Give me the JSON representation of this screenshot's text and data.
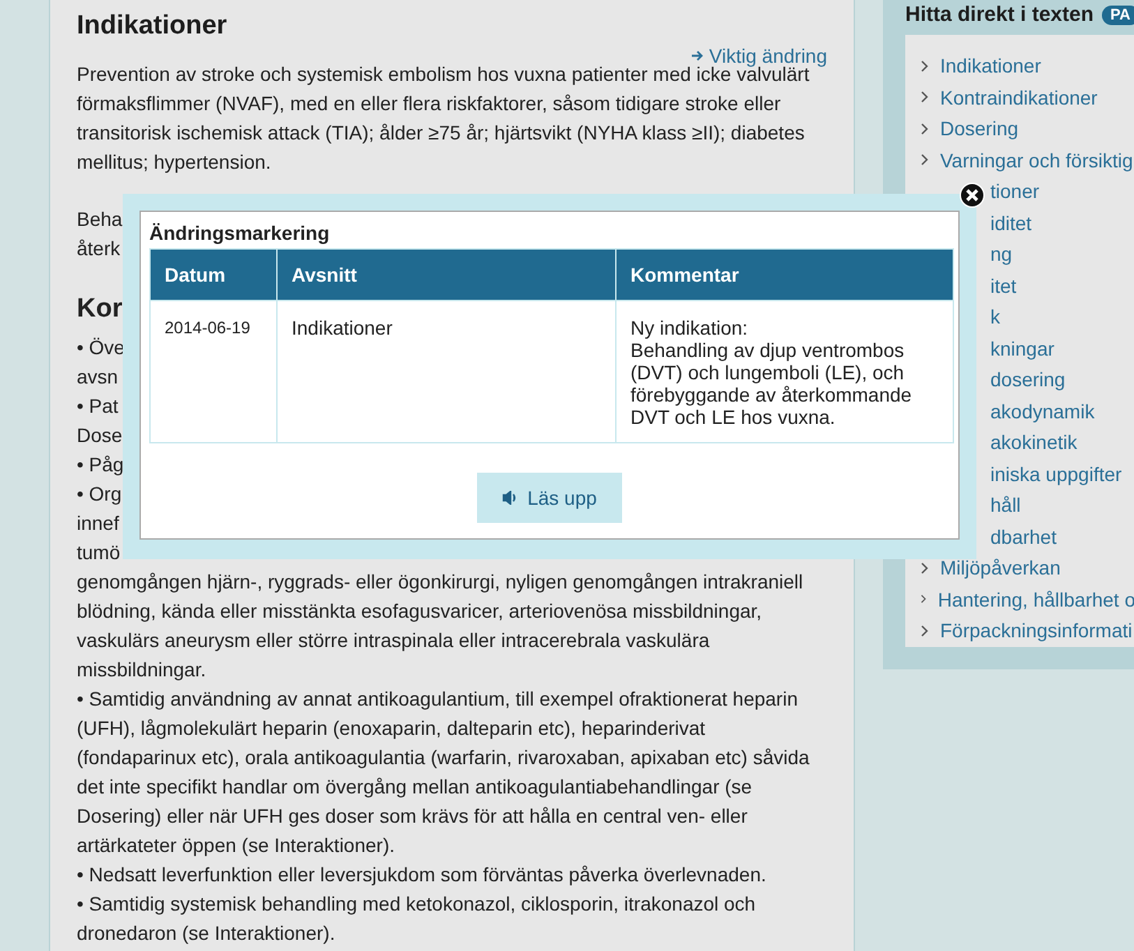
{
  "article": {
    "title": "Indikationer",
    "change_link": "Viktig ändring",
    "paragraph": "Prevention av stroke och systemisk embolism hos vuxna patienter med icke valvulärt förmaksflimmer (NVAF), med en eller flera riskfaktorer, såsom tidigare stroke eller transitorisk ischemisk attack (TIA); ålder ≥75 år; hjärtsvikt (NYHA klass ≥II); diabetes mellitus; hypertension.",
    "covered_lines": [
      {
        "text": "Beha",
        "kind": "text"
      },
      {
        "text": "återk",
        "kind": "text"
      },
      {
        "text": "Kor",
        "kind": "heading"
      },
      {
        "text": "• Öve",
        "kind": "text"
      },
      {
        "text": "avsn",
        "kind": "text"
      },
      {
        "text": "• Pat",
        "kind": "text"
      },
      {
        "text": "Dose",
        "kind": "text"
      },
      {
        "text": "• Påg",
        "kind": "text"
      },
      {
        "text": "• Org",
        "kind": "text"
      },
      {
        "text": "innef",
        "kind": "text"
      },
      {
        "text": "tumö",
        "kind": "text"
      }
    ],
    "continued_text": "genomgången hjärn-, ryggrads- eller ögonkirurgi, nyligen genomgången intrakraniell blödning, kända eller misstänkta esofagusvaricer, arteriovenösa missbildningar, vaskulärs aneurysm eller större intraspinala eller intracerebrala vaskulära missbildningar.",
    "bullets": [
      "• Samtidig användning av annat antikoagulantium, till exempel ofraktionerat heparin (UFH), lågmolekulärt heparin (enoxaparin, dalteparin etc), heparinderivat (fondaparinux etc), orala antikoagulantia (warfarin, rivaroxaban, apixaban etc) såvida det inte specifikt handlar om övergång mellan antikoagulantiabehandlingar (se Dosering) eller när UFH ges doser som krävs för att hålla en central ven- eller artärkateter öppen (se Interaktioner).",
      "• Nedsatt leverfunktion eller leversjukdom som förväntas påverka överlevnaden.",
      "• Samtidig systemisk behandling med ketokonazol, ciklosporin, itrakonazol och dronedaron (se Interaktioner)."
    ]
  },
  "sidebar": {
    "title": "Hitta direkt i texten",
    "badge": "PA",
    "items": [
      {
        "label": "Indikationer",
        "kind": "full"
      },
      {
        "label": "Kontraindikationer",
        "kind": "full"
      },
      {
        "label": "Dosering",
        "kind": "full"
      },
      {
        "label": "Varningar och försiktig",
        "kind": "full"
      },
      {
        "label": "tioner",
        "kind": "partial"
      },
      {
        "label": "iditet",
        "kind": "partial"
      },
      {
        "label": "ng",
        "kind": "partial"
      },
      {
        "label": "itet",
        "kind": "partial"
      },
      {
        "label": "k",
        "kind": "partial"
      },
      {
        "label": "kningar",
        "kind": "partial"
      },
      {
        "label": "dosering",
        "kind": "partial"
      },
      {
        "label": "akodynamik",
        "kind": "partial"
      },
      {
        "label": "akokinetik",
        "kind": "partial"
      },
      {
        "label": "iniska uppgifter",
        "kind": "partial"
      },
      {
        "label": "håll",
        "kind": "partial"
      },
      {
        "label": "dbarhet",
        "kind": "partial"
      },
      {
        "label": "Miljöpåverkan",
        "kind": "full"
      },
      {
        "label": "Hantering, hållbarhet o",
        "kind": "full"
      },
      {
        "label": "Förpackningsinformati",
        "kind": "full"
      }
    ]
  },
  "dialog": {
    "title": "Ändringsmarkering",
    "columns": [
      "Datum",
      "Avsnitt",
      "Kommentar"
    ],
    "rows": [
      {
        "date": "2014-06-19",
        "section": "Indikationer",
        "comment_lines": [
          "Ny indikation:",
          "Behandling av djup ventrombos (DVT) och lungemboli (LE), och förebyggande av återkommande DVT och LE hos vuxna."
        ]
      }
    ],
    "button": "Läs upp"
  }
}
